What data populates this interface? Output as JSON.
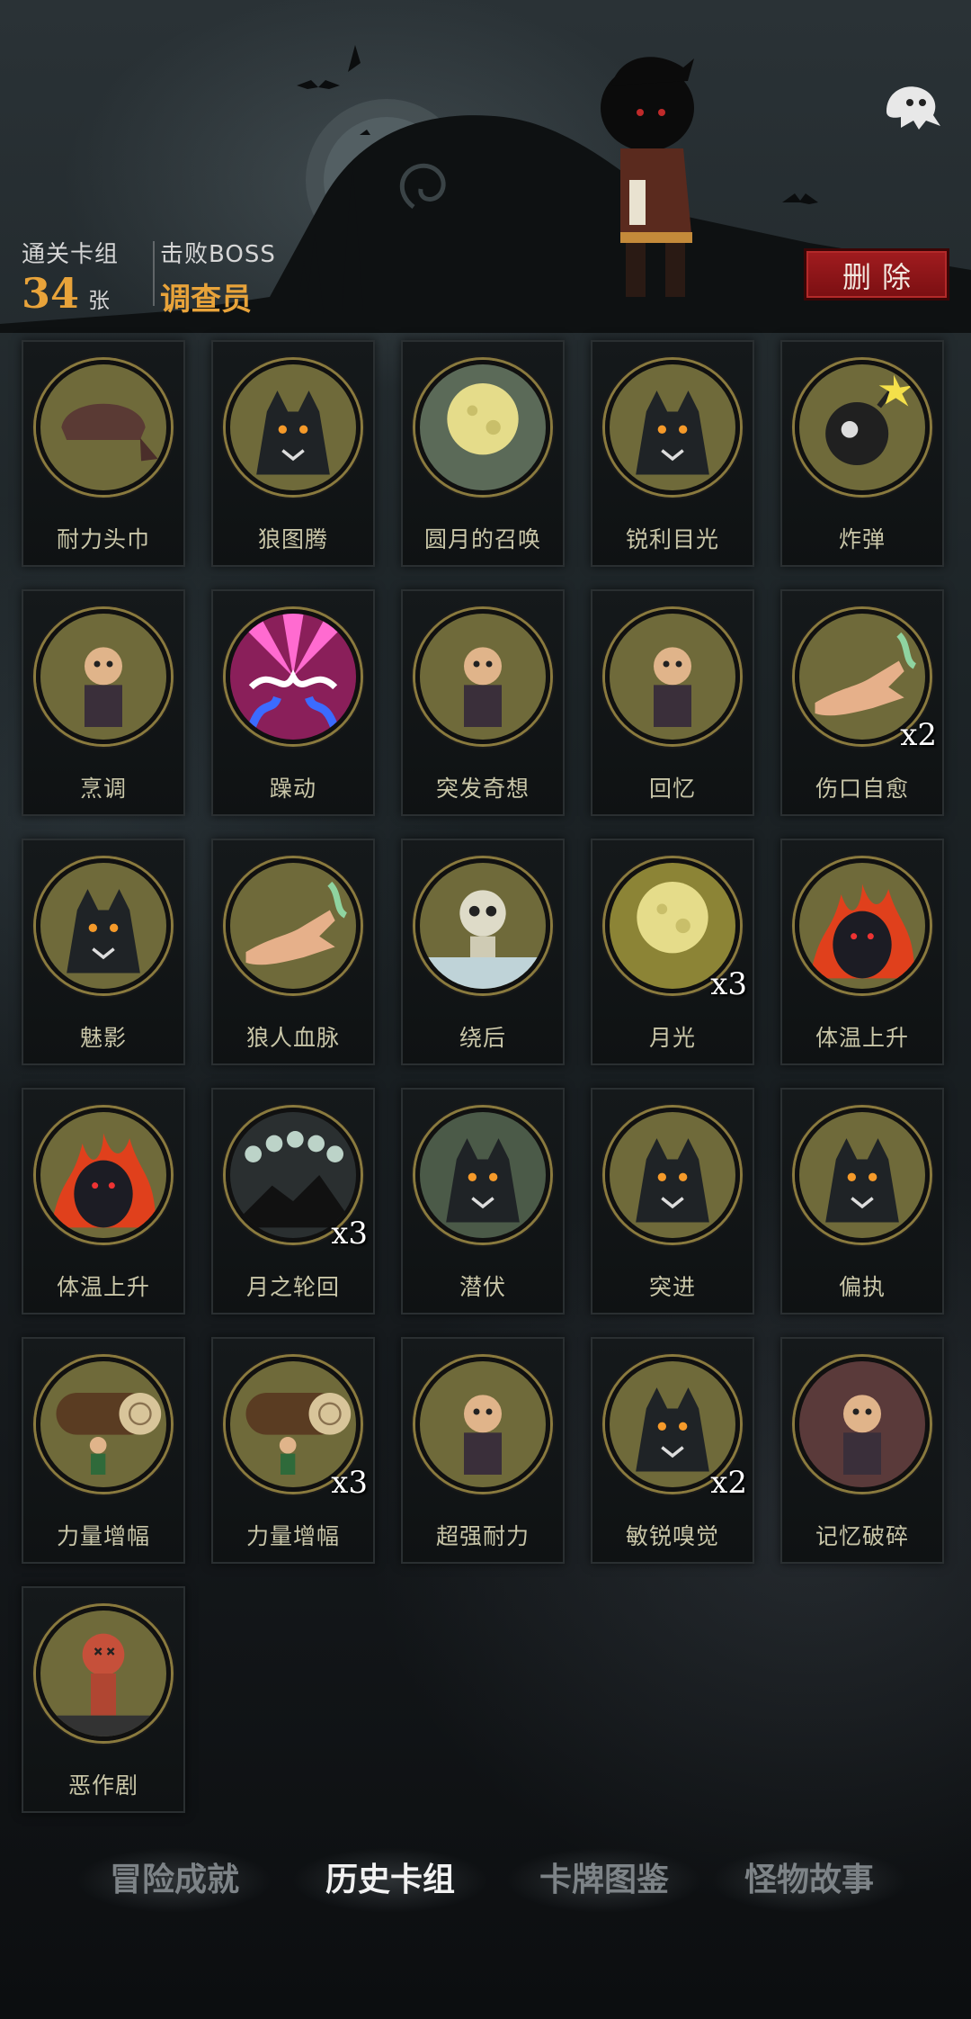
{
  "header": {
    "cleared_label": "通关卡组",
    "cleared_value": "34",
    "cleared_unit": "张",
    "boss_label": "击败BOSS",
    "boss_value": "调查员",
    "delete_label": "删除"
  },
  "cards": [
    {
      "name": "耐力头巾",
      "count": "",
      "icon": "bandana-icon",
      "bg": "#6f6a3a"
    },
    {
      "name": "狼图腾",
      "count": "",
      "icon": "wolf-totem-icon",
      "bg": "#6f6a3a"
    },
    {
      "name": "圆月的召唤",
      "count": "",
      "icon": "full-moon-forest-icon",
      "bg": "#5b6a58"
    },
    {
      "name": "锐利目光",
      "count": "",
      "icon": "werewolf-eyes-icon",
      "bg": "#6f6a3a"
    },
    {
      "name": "炸弹",
      "count": "",
      "icon": "skull-bomb-icon",
      "bg": "#6f6a3a"
    },
    {
      "name": "烹调",
      "count": "",
      "icon": "fox-chef-icon",
      "bg": "#6f6a3a"
    },
    {
      "name": "躁动",
      "count": "",
      "icon": "frenzy-icon",
      "bg": "#8a1f5a"
    },
    {
      "name": "突发奇想",
      "count": "",
      "icon": "inventor-icon",
      "bg": "#6f6a3a"
    },
    {
      "name": "回忆",
      "count": "",
      "icon": "old-man-icon",
      "bg": "#6f6a3a"
    },
    {
      "name": "伤口自愈",
      "count": "x2",
      "icon": "healing-hand-icon",
      "bg": "#6f6a3a"
    },
    {
      "name": "魅影",
      "count": "",
      "icon": "phantom-wolf-icon",
      "bg": "#6f6a3a"
    },
    {
      "name": "狼人血脉",
      "count": "",
      "icon": "bloodline-hand-icon",
      "bg": "#6f6a3a"
    },
    {
      "name": "绕后",
      "count": "",
      "icon": "skeleton-pirate-icon",
      "bg": "#6f6a3a"
    },
    {
      "name": "月光",
      "count": "x3",
      "icon": "moonlight-icon",
      "bg": "#8c8436"
    },
    {
      "name": "体温上升",
      "count": "",
      "icon": "fire-wolf-icon",
      "bg": "#6f6a3a"
    },
    {
      "name": "体温上升",
      "count": "",
      "icon": "fire-wolf-icon",
      "bg": "#6f6a3a"
    },
    {
      "name": "月之轮回",
      "count": "x3",
      "icon": "moon-phases-icon",
      "bg": "#2a2f30"
    },
    {
      "name": "潜伏",
      "count": "",
      "icon": "lurking-wolf-icon",
      "bg": "#4b5a48"
    },
    {
      "name": "突进",
      "count": "",
      "icon": "charging-wolf-icon",
      "bg": "#6f6a3a"
    },
    {
      "name": "偏执",
      "count": "",
      "icon": "wolf-bear-icon",
      "bg": "#6f6a3a"
    },
    {
      "name": "力量增幅",
      "count": "",
      "icon": "log-carry-icon",
      "bg": "#6f6a3a"
    },
    {
      "name": "力量增幅",
      "count": "x3",
      "icon": "log-carry-icon",
      "bg": "#6f6a3a"
    },
    {
      "name": "超强耐力",
      "count": "",
      "icon": "endurance-icon",
      "bg": "#6f6a3a"
    },
    {
      "name": "敏锐嗅觉",
      "count": "x2",
      "icon": "sniffing-wolf-icon",
      "bg": "#6f6a3a"
    },
    {
      "name": "记忆破碎",
      "count": "",
      "icon": "shattered-memory-icon",
      "bg": "#5a3a3a"
    },
    {
      "name": "恶作剧",
      "count": "",
      "icon": "voodoo-doll-icon",
      "bg": "#6f6a3a"
    }
  ],
  "tabs": [
    {
      "label": "冒险成就",
      "active": false
    },
    {
      "label": "历史卡组",
      "active": true
    },
    {
      "label": "卡牌图鉴",
      "active": false
    },
    {
      "label": "怪物故事",
      "active": false
    }
  ]
}
